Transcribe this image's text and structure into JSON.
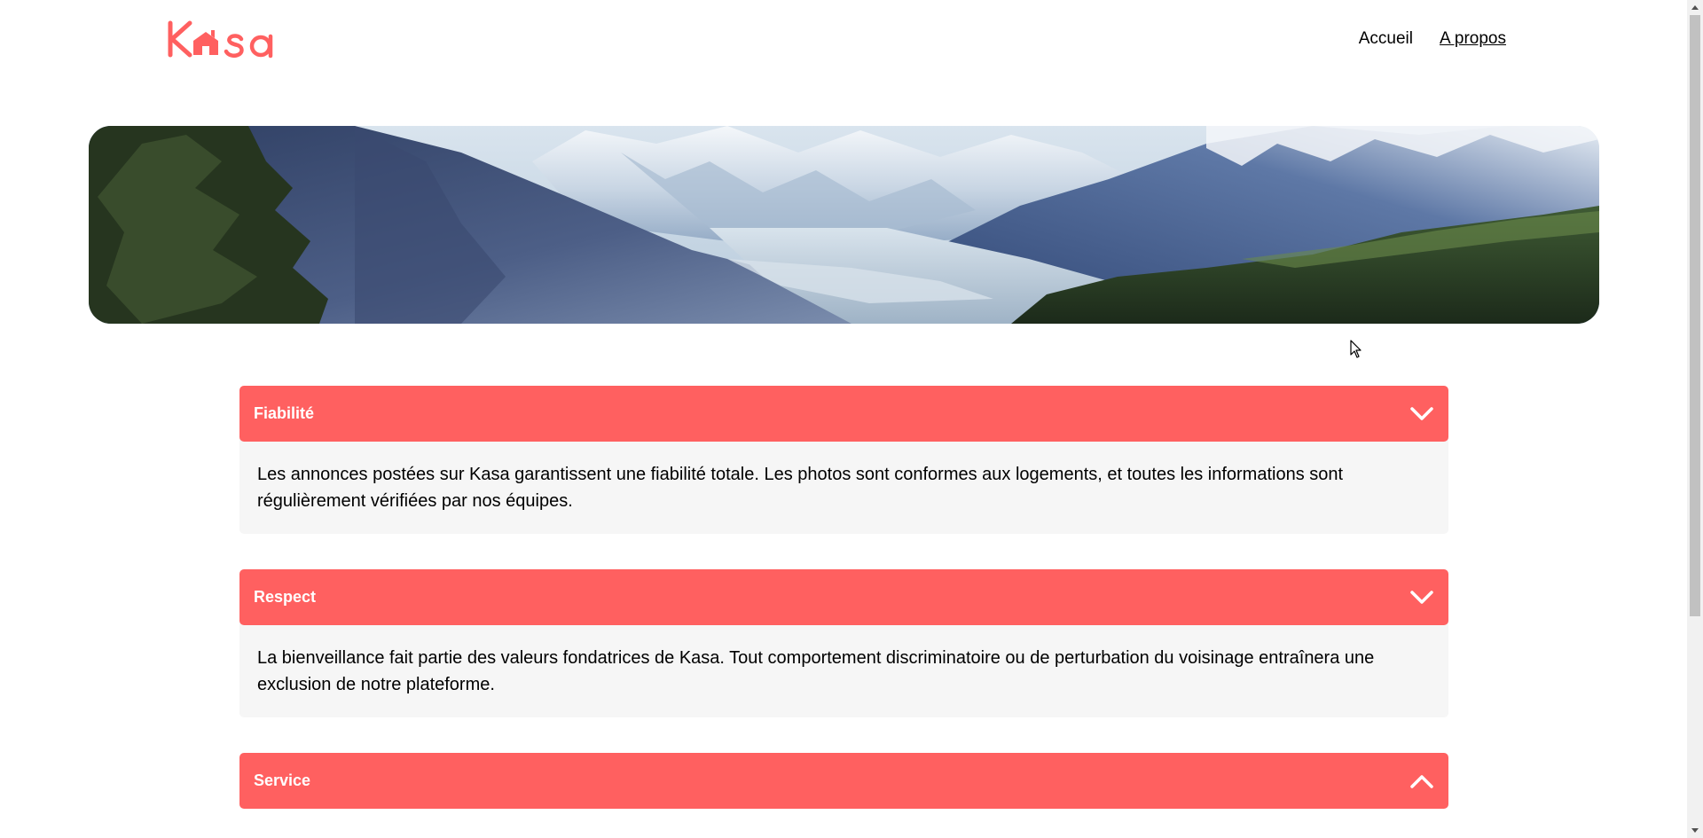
{
  "brand": {
    "logo_text": "Kasa",
    "accent_color": "#FF6060"
  },
  "nav": {
    "items": [
      {
        "label": "Accueil",
        "active": false
      },
      {
        "label": "A propos",
        "active": true
      }
    ]
  },
  "banner": {
    "image": "mountain-valley-landscape"
  },
  "collapses": [
    {
      "title": "Fiabilité",
      "open": true,
      "icon": "chevron-down-icon",
      "content": "Les annonces postées sur Kasa garantissent une fiabilité totale. Les photos sont conformes aux logements, et toutes les informations sont régulièrement vérifiées par nos équipes."
    },
    {
      "title": "Respect",
      "open": true,
      "icon": "chevron-down-icon",
      "content": "La bienveillance fait partie des valeurs fondatrices de Kasa. Tout comportement discriminatoire ou de perturbation du voisinage entraînera une exclusion de notre plateforme."
    },
    {
      "title": "Service",
      "open": false,
      "icon": "chevron-up-icon",
      "content": ""
    }
  ]
}
